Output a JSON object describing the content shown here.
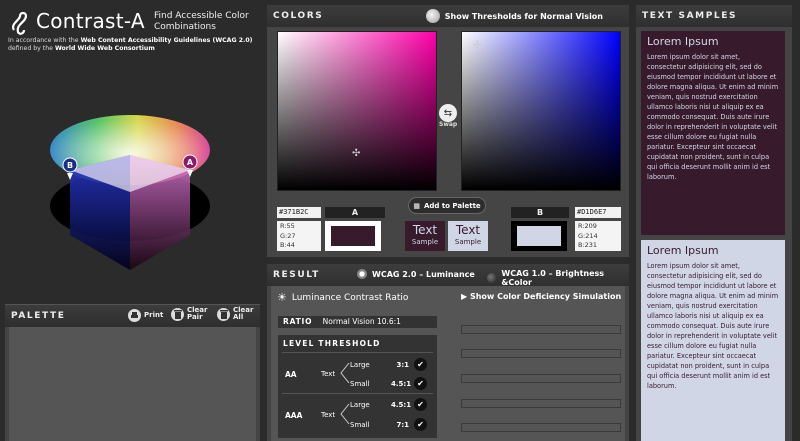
{
  "app": {
    "title": "Contrast-A",
    "tagline": "Find Accessible Color Combinations",
    "subtitle_prefix": "In accordance with the",
    "subtitle_guidelines": "Web Content Accessibility Guidelines (WCAG 2.0)",
    "subtitle_mid": "defined by the",
    "subtitle_consortium": "World Wide Web Consortium"
  },
  "wheel": {
    "marker_b": "B",
    "marker_a": "A"
  },
  "palette": {
    "title": "PALETTE",
    "print_label": "Print",
    "clear_pair_label": "Clear Pair",
    "clear_all_label": "Clear All"
  },
  "colors": {
    "title": "COLORS",
    "thresholds_toggle": "Show Thresholds for Normal Vision",
    "swap_label": "Swap",
    "add_to_palette": "Add to Palette",
    "a": {
      "label": "A",
      "hex": "#371B2C",
      "r": "R:55",
      "g": "G:27",
      "b": "B:44",
      "color": "#371B2C"
    },
    "b": {
      "label": "B",
      "hex": "#D1D6E7",
      "r": "R:209",
      "g": "G:214",
      "b": "B:231",
      "color": "#D1D6E7"
    },
    "sample_dark": {
      "big": "Text",
      "small": "Sample"
    },
    "sample_light": {
      "big": "Text",
      "small": "Sample"
    }
  },
  "result": {
    "title": "RESULT",
    "option_wcag2": "WCAG 2.0 – Luminance",
    "option_wcag1": "WCAG 1.0 – Brightness &Color",
    "luminance_header": "Luminance Contrast Ratio",
    "deficiency_link": "▶ Show Color Deficiency Simulation",
    "ratio_label": "RATIO",
    "ratio_value": "Normal Vision  10.6:1",
    "threshold_header": "LEVEL   THRESHOLD",
    "aa": {
      "level": "AA",
      "text": "Text",
      "large": "Large",
      "large_val": "3:1",
      "small": "Small",
      "small_val": "4.5:1"
    },
    "aaa": {
      "level": "AAA",
      "text": "Text",
      "large": "Large",
      "large_val": "4.5:1",
      "small": "Small",
      "small_val": "7:1"
    }
  },
  "samples": {
    "title": "TEXT SAMPLES",
    "heading": "Lorem Ipsum",
    "body": "Lorem ipsum dolor sit amet, consectetur adipisicing elit, sed do eiusmod tempor incididunt ut labore et dolore magna aliqua. Ut enim ad minim veniam, quis nostrud exercitation ullamco laboris nisi ut aliquip ex ea commodo consequat. Duis aute irure dolor in reprehenderit in voluptate velit esse cillum dolore eu fugiat nulla pariatur. Excepteur sint occaecat cupidatat non proident, sunt in culpa qui officia deserunt mollit anim id est laborum."
  }
}
